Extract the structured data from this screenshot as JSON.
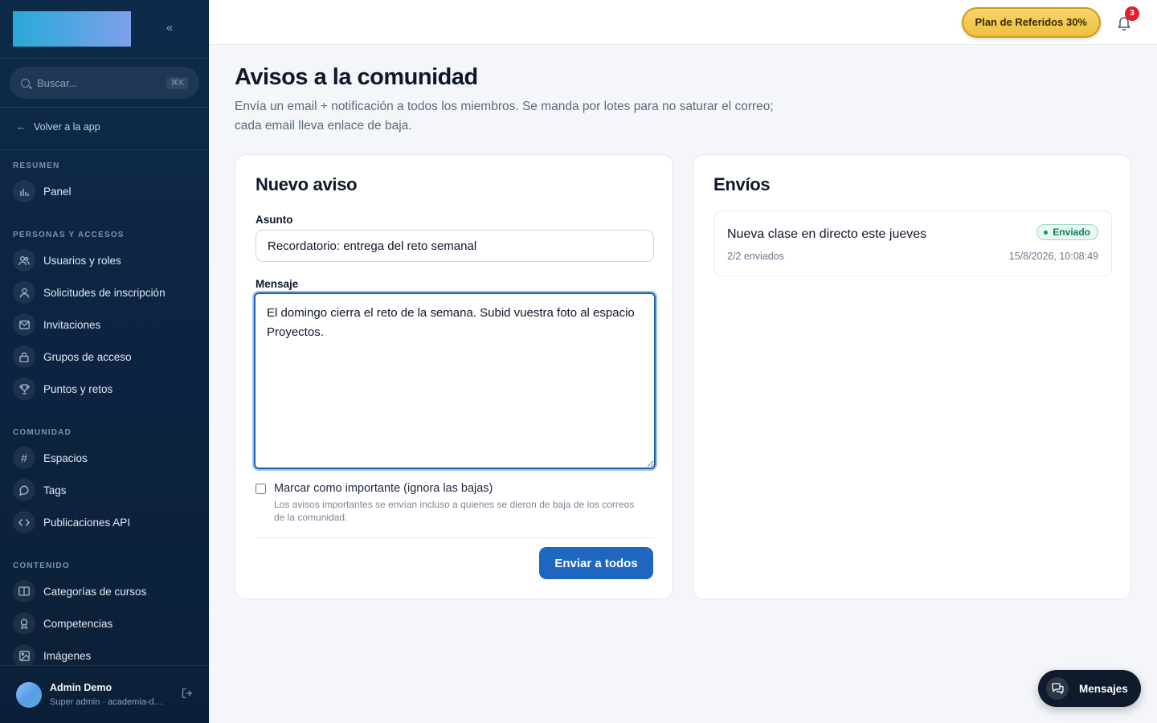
{
  "sidebar": {
    "search_placeholder": "Buscar...",
    "search_shortcut": "⌘K",
    "back_label": "Volver a la app",
    "sections": {
      "resumen": "RESUMEN",
      "personas": "PERSONAS Y ACCESOS",
      "comunidad": "COMUNIDAD",
      "contenido": "CONTENIDO"
    },
    "items": {
      "panel": "Panel",
      "usuarios": "Usuarios y roles",
      "solicitudes": "Solicitudes de inscripción",
      "invitaciones": "Invitaciones",
      "grupos": "Grupos de acceso",
      "puntos": "Puntos y retos",
      "espacios": "Espacios",
      "tags": "Tags",
      "publicaciones": "Publicaciones API",
      "categorias": "Categorías de cursos",
      "competencias": "Competencias",
      "imagenes": "Imágenes"
    },
    "user": {
      "name": "Admin Demo",
      "role": "Super admin · academia-demo"
    }
  },
  "topbar": {
    "promo_label": "Plan de Referidos 30%",
    "notifications_count": "3"
  },
  "page": {
    "title": "Avisos a la comunidad",
    "description": "Envía un email + notificación a todos los miembros. Se manda por lotes para no saturar el correo; cada email lleva enlace de baja."
  },
  "form": {
    "title": "Nuevo aviso",
    "subject_label": "Asunto",
    "subject_value": "Recordatorio: entrega del reto semanal",
    "message_label": "Mensaje",
    "message_value": "El domingo cierra el reto de la semana. Subid vuestra foto al espacio Proyectos.",
    "important_label": "Marcar como importante (ignora las bajas)",
    "important_help": "Los avisos importantes se envían incluso a quienes se dieron de baja de los correos de la comunidad.",
    "send_label": "Enviar a todos"
  },
  "sends": {
    "title": "Envíos",
    "items": [
      {
        "title": "Nueva clase en directo este jueves",
        "status": "Enviado",
        "count": "2/2 enviados",
        "date": "15/8/2026, 10:08:49"
      }
    ]
  },
  "messages_button": "Mensajes",
  "colors": {
    "sidebar_bg": "#0c2440",
    "primary": "#1f66c1",
    "success": "#127a58",
    "promo": "#f0bf3d",
    "badge": "#e11d2f"
  }
}
